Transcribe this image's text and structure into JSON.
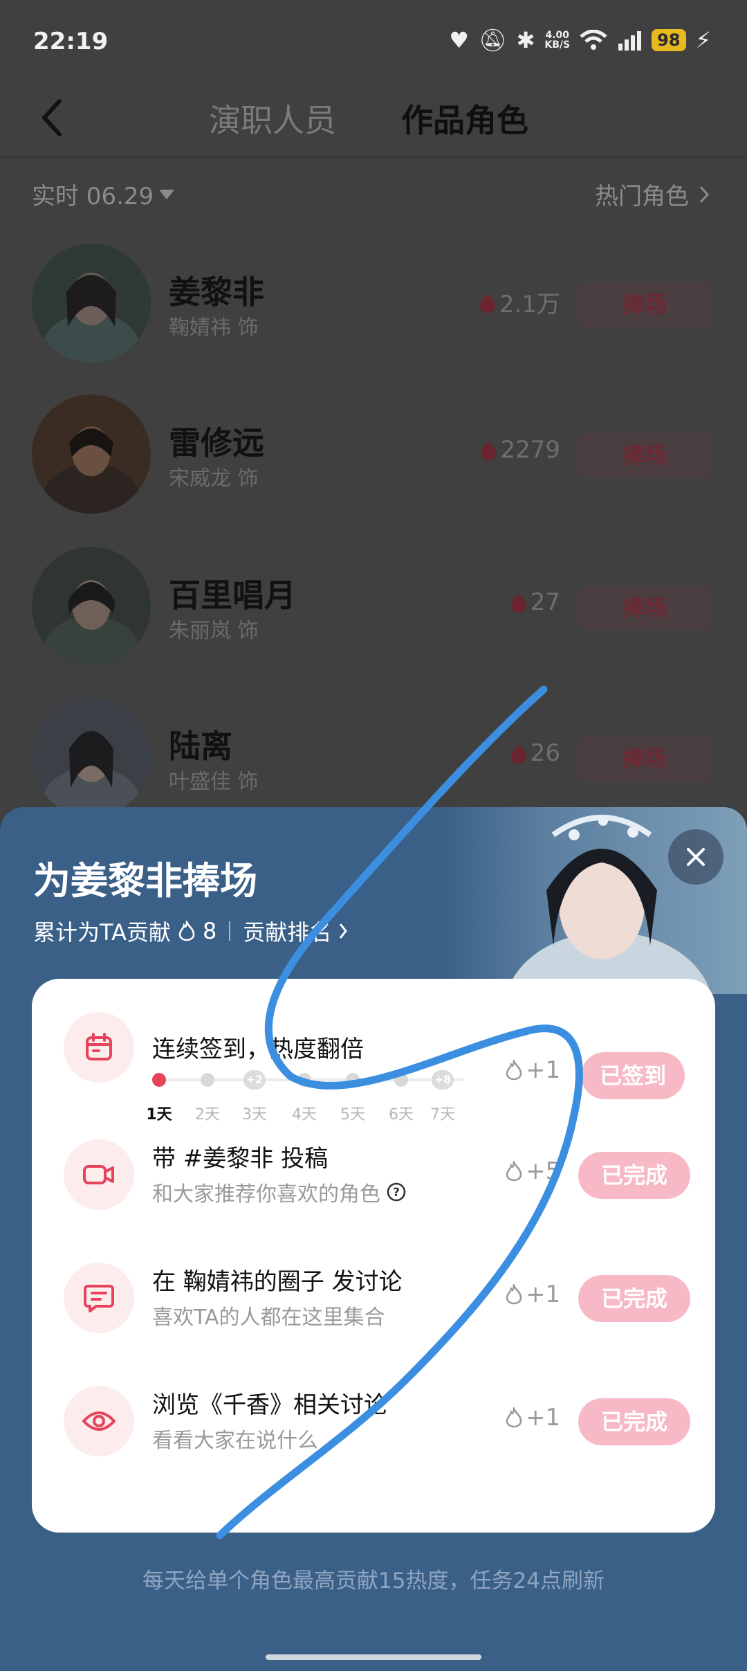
{
  "status_bar": {
    "time": "22:19",
    "net_speed_value": "4.00",
    "net_speed_unit": "KB/S",
    "battery": "98"
  },
  "nav": {
    "tabs": [
      {
        "label": "演职人员"
      },
      {
        "label": "作品角色"
      }
    ]
  },
  "filter": {
    "date": "实时 06.29",
    "hot_roles": "热门角色"
  },
  "roles": [
    {
      "name": "姜黎非",
      "actor": "鞠婧祎 饰",
      "heat": "2.1万",
      "button": "捧场"
    },
    {
      "name": "雷修远",
      "actor": "宋威龙 饰",
      "heat": "2279",
      "button": "捧场"
    },
    {
      "name": "百里唱月",
      "actor": "朱丽岚 饰",
      "heat": "27",
      "button": "捧场"
    },
    {
      "name": "陆离",
      "actor": "叶盛佳 饰",
      "heat": "26",
      "button": "捧场"
    }
  ],
  "sheet": {
    "title": "为姜黎非捧场",
    "contribution_label": "累计为TA贡献",
    "contribution_value": "8",
    "ranking_link": "贡献排名",
    "tasks": [
      {
        "title": "连续签到，热度翻倍",
        "reward": "+1",
        "button": "已签到",
        "icon": "calendar-icon",
        "days": [
          "1天",
          "2天",
          "3天",
          "4天",
          "5天",
          "6天",
          "7天"
        ],
        "bonus_day3": "+2",
        "bonus_day7": "+8",
        "current_day": 1
      },
      {
        "title": "带 #姜黎非 投稿",
        "desc": "和大家推荐你喜欢的角色",
        "reward": "+5",
        "button": "已完成",
        "icon": "video-camera-icon"
      },
      {
        "title": "在 鞠婧祎的圈子 发讨论",
        "desc": "喜欢TA的人都在这里集合",
        "reward": "+1",
        "button": "已完成",
        "icon": "comment-icon"
      },
      {
        "title": "浏览《千香》相关讨论",
        "desc": "看看大家在说什么",
        "reward": "+1",
        "button": "已完成",
        "icon": "eye-icon"
      }
    ],
    "footer": "每天给单个角色最高贡献15热度，任务24点刷新"
  },
  "colors": {
    "accent_red": "#e8435c",
    "done_button": "#f7b9c6",
    "sheet_bg": "#3a6088",
    "scribble": "#3b8ee0"
  }
}
